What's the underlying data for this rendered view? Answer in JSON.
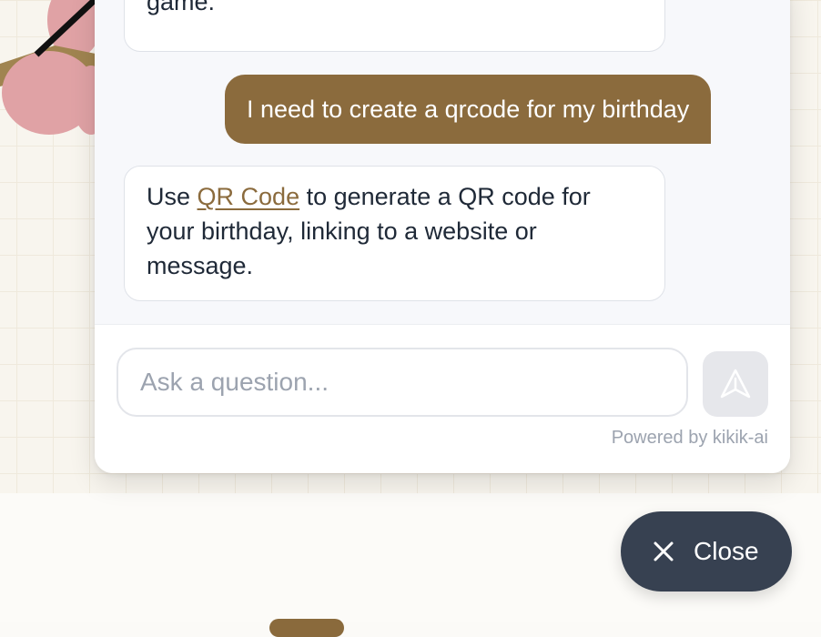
{
  "chat": {
    "messages": [
      {
        "role": "bot",
        "text": "game."
      },
      {
        "role": "user",
        "text": "I need to create a qrcode for my birthday"
      },
      {
        "role": "bot",
        "pre": "Use ",
        "link": "QR Code",
        "post": " to generate a QR code for your birthday, linking to a website or message."
      }
    ],
    "input_placeholder": "Ask a question...",
    "send_icon": "send-icon",
    "powered_by": "Powered by kikik-ai"
  },
  "close_button": {
    "label": "Close",
    "icon": "close-icon"
  },
  "colors": {
    "accent": "#8b6b3d",
    "close_bg": "#374151",
    "send_bg": "#e6e7eb"
  }
}
